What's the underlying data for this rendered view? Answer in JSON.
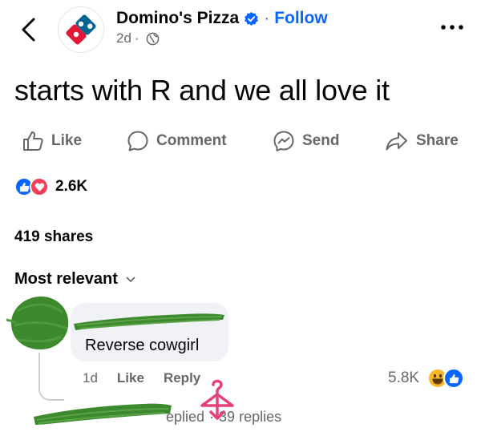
{
  "header": {
    "page_name": "Domino's Pizza",
    "separator": "·",
    "follow_label": "Follow",
    "time": "2d",
    "meta_separator": "·"
  },
  "post": {
    "text": "starts with R and we all love it"
  },
  "actions": {
    "like": "Like",
    "comment": "Comment",
    "send": "Send",
    "share": "Share"
  },
  "stats": {
    "reaction_count": "2.6K",
    "shares": "419 shares"
  },
  "comments": {
    "sort_label": "Most relevant",
    "items": [
      {
        "text": "Reverse cowgirl",
        "time": "1d",
        "like_label": "Like",
        "reply_label": "Reply",
        "reaction_count": "5.8K",
        "replied_fragment": "eplied",
        "replied_separator": "·",
        "replies_count": "39 replies"
      }
    ]
  },
  "colors": {
    "accent": "#0866ff",
    "secondary_text": "#65676b",
    "redaction_green": "#3d8a2e",
    "annotation_pink": "#e5407a"
  }
}
